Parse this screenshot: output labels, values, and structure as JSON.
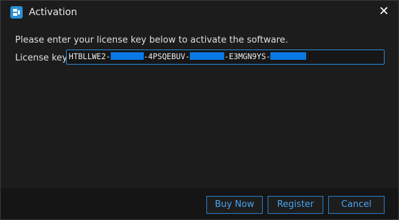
{
  "window": {
    "title": "Activation",
    "close_glyph": "✕",
    "icon": "app-icon"
  },
  "body": {
    "prompt": "Please enter your license key below to activate the software.",
    "license_label": "License key:",
    "license_value_parts": [
      "HTBLLWE2-",
      "",
      "-4PSQEBUV-",
      "",
      "-E3MGN9YS-",
      ""
    ],
    "license_redactions": [
      "redacted",
      "redacted",
      "redacted"
    ]
  },
  "buttons": {
    "buy": "Buy Now",
    "register": "Register",
    "cancel": "Cancel"
  },
  "colors": {
    "accent": "#2c7fd0",
    "button_text": "#4aa3f0",
    "redaction": "#0a78e6",
    "background": "#1c1c1c",
    "footer": "#151515"
  }
}
